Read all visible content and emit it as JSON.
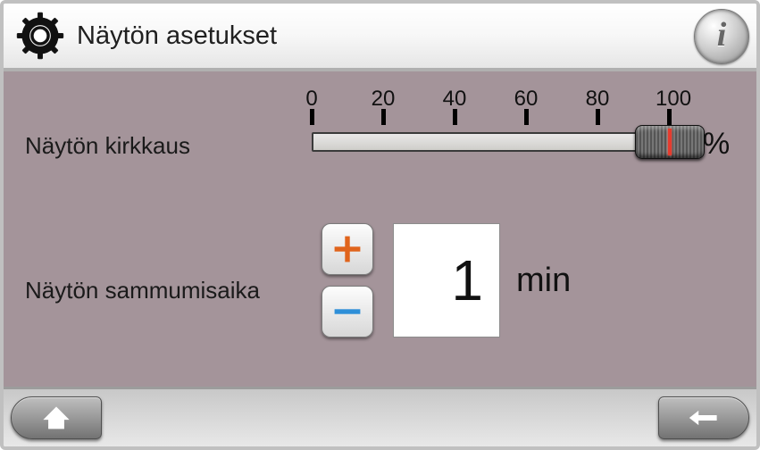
{
  "header": {
    "title": "Näytön asetukset"
  },
  "brightness": {
    "label": "Näytön kirkkaus",
    "unit": "%",
    "ticks": [
      "0",
      "20",
      "40",
      "60",
      "80",
      "100"
    ],
    "min": 0,
    "max": 100,
    "value": 100
  },
  "timeout": {
    "label": "Näytön sammumisaika",
    "value": "1",
    "unit": "min"
  }
}
